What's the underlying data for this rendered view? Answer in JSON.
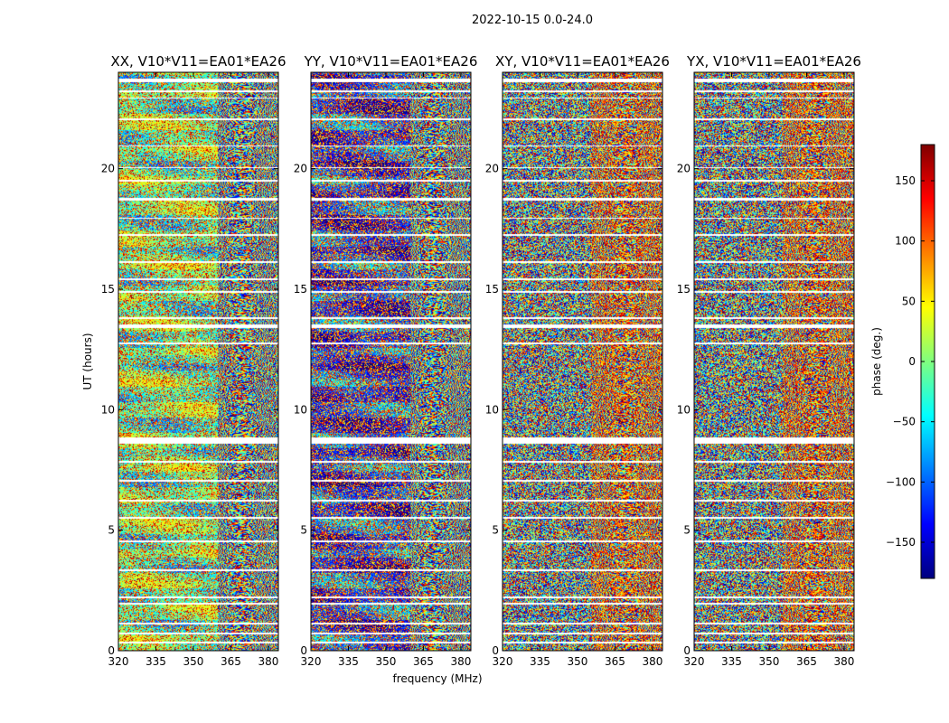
{
  "figure_title": "2022-10-15 0.0-24.0",
  "colors": {
    "jet": [
      "#00007f",
      "#0000ff",
      "#007fff",
      "#00ffff",
      "#7fff7f",
      "#ffff00",
      "#ff7f00",
      "#ff0000",
      "#7f0000"
    ],
    "flag_background": "#ffffff"
  },
  "chart_data": [
    {
      "type": "heatmap",
      "title": "XX, V10*V11=EA01*EA26",
      "xlabel": "",
      "ylabel": "UT (hours)",
      "xlim": [
        320,
        384
      ],
      "ylim": [
        0,
        24
      ],
      "xticks": [
        320,
        335,
        350,
        365,
        380
      ],
      "yticks": [
        0,
        5,
        10,
        15,
        20
      ],
      "value_range": [
        -180,
        180
      ]
    },
    {
      "type": "heatmap",
      "title": "YY, V10*V11=EA01*EA26",
      "xlabel": "frequency (MHz)",
      "ylabel": "",
      "xlim": [
        320,
        384
      ],
      "ylim": [
        0,
        24
      ],
      "xticks": [
        320,
        335,
        350,
        365,
        380
      ],
      "yticks": [
        0,
        5,
        10,
        15,
        20
      ],
      "value_range": [
        -180,
        180
      ]
    },
    {
      "type": "heatmap",
      "title": "XY, V10*V11=EA01*EA26",
      "xlabel": "",
      "ylabel": "",
      "xlim": [
        320,
        384
      ],
      "ylim": [
        0,
        24
      ],
      "xticks": [
        320,
        335,
        350,
        365,
        380
      ],
      "yticks": [
        0,
        5,
        10,
        15,
        20
      ],
      "value_range": [
        -180,
        180
      ]
    },
    {
      "type": "heatmap",
      "title": "YX, V10*V11=EA01*EA26",
      "xlabel": "",
      "ylabel": "",
      "xlim": [
        320,
        384
      ],
      "ylim": [
        0,
        24
      ],
      "xticks": [
        320,
        335,
        350,
        365,
        380
      ],
      "yticks": [
        0,
        5,
        10,
        15,
        20
      ],
      "value_range": [
        -180,
        180
      ]
    }
  ],
  "colorbar": {
    "label": "phase (deg.)",
    "range": [
      -180,
      180
    ],
    "ticks": [
      150,
      100,
      50,
      0,
      -50,
      -100,
      -150
    ],
    "tick_labels": [
      "150",
      "100",
      "50",
      "0",
      "−50",
      "−100",
      "−150"
    ]
  },
  "flagged_ut_hours": [
    [
      23.6,
      23.72
    ],
    [
      23.18,
      23.26
    ],
    [
      22.9,
      22.96
    ],
    [
      22.02,
      22.1
    ],
    [
      20.92,
      20.98
    ],
    [
      20.02,
      20.08
    ],
    [
      19.45,
      19.52
    ],
    [
      18.68,
      18.78
    ],
    [
      17.92,
      17.98
    ],
    [
      17.2,
      17.28
    ],
    [
      16.08,
      16.16
    ],
    [
      15.38,
      15.46
    ],
    [
      14.86,
      14.94
    ],
    [
      13.75,
      13.85
    ],
    [
      13.4,
      13.55
    ],
    [
      12.72,
      12.8
    ],
    [
      8.6,
      8.85
    ],
    [
      7.8,
      7.86
    ],
    [
      7.02,
      7.08
    ],
    [
      6.18,
      6.26
    ],
    [
      5.48,
      5.54
    ],
    [
      4.5,
      4.56
    ],
    [
      3.3,
      3.38
    ],
    [
      2.16,
      2.26
    ],
    [
      1.92,
      2.0
    ],
    [
      1.1,
      1.16
    ],
    [
      0.68,
      0.76
    ],
    [
      0.3,
      0.36
    ]
  ]
}
